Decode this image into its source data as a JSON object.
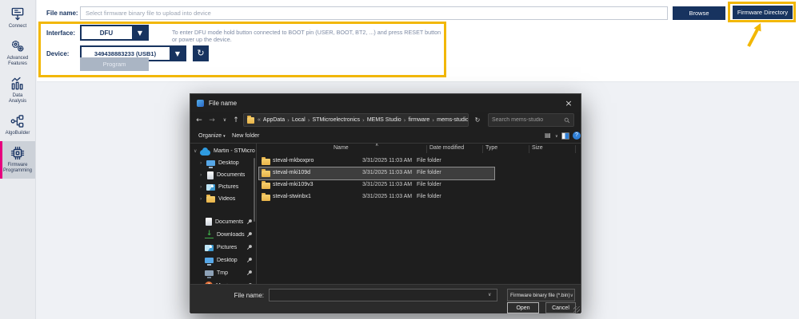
{
  "app": {
    "sidebar": {
      "items": [
        {
          "label": "Connect",
          "icon": "connect",
          "selected": false
        },
        {
          "label": "Advanced Features",
          "icon": "gears",
          "selected": false
        },
        {
          "label": "Data Analysis",
          "icon": "chart",
          "selected": false
        },
        {
          "label": "AlgoBuilder",
          "icon": "algo",
          "selected": false
        },
        {
          "label": "Firmware Programming",
          "icon": "chip",
          "selected": true
        }
      ]
    }
  },
  "firmware": {
    "file_name_label": "File name:",
    "file_input_placeholder": "Select firmware binary file to upload into device",
    "browse_button": "Browse",
    "firmware_directory_button": "Firmware Directory",
    "interface_label": "Interface:",
    "interface_value": "DFU",
    "dfu_note": "To enter DFU mode hold button connected to BOOT pin (USER, BOOT, BT2, ...) and press RESET button or power up the device.",
    "device_label": "Device:",
    "device_value": "349438883233 (USB1)",
    "program_button": "Program"
  },
  "dialog": {
    "title": "File name",
    "address": {
      "overflow": "«",
      "crumbs": [
        "AppData",
        "Local",
        "STMicroelectronics",
        "MEMS Studio",
        "firmware",
        "mems-studio"
      ]
    },
    "search_placeholder": "Search mems-studio",
    "toolbar": {
      "organize": "Organize",
      "new_folder": "New folder"
    },
    "tree": {
      "group1_root": {
        "label": "Martin - STMicro",
        "icon": "cloud"
      },
      "group1_children": [
        {
          "label": "Desktop",
          "icon": "monitor"
        },
        {
          "label": "Documents",
          "icon": "doc"
        },
        {
          "label": "Pictures",
          "icon": "pic"
        },
        {
          "label": "Videos",
          "icon": "folder"
        }
      ],
      "group2": [
        {
          "label": "Documents",
          "icon": "doc"
        },
        {
          "label": "Downloads",
          "icon": "download"
        },
        {
          "label": "Pictures",
          "icon": "pic"
        },
        {
          "label": "Desktop",
          "icon": "monitor"
        },
        {
          "label": "Tmp",
          "icon": "monitor2"
        },
        {
          "label": "Music",
          "icon": "music"
        }
      ]
    },
    "list": {
      "columns": [
        "Name",
        "Date modified",
        "Type",
        "Size"
      ],
      "rows": [
        {
          "name": "steval-mkboxpro",
          "date": "3/31/2025 11:03 AM",
          "type": "File folder",
          "selected": false
        },
        {
          "name": "steval-mki109d",
          "date": "3/31/2025 11:03 AM",
          "type": "File folder",
          "selected": true
        },
        {
          "name": "steval-mki109v3",
          "date": "3/31/2025 11:03 AM",
          "type": "File folder",
          "selected": false
        },
        {
          "name": "steval-stwinbx1",
          "date": "3/31/2025 11:03 AM",
          "type": "File folder",
          "selected": false
        }
      ]
    },
    "footer": {
      "file_name_label": "File name:",
      "file_name_value": "",
      "file_type_value": "Firmware binary file (*.bin)",
      "open_button": "Open",
      "cancel_button": "Cancel"
    }
  },
  "colors": {
    "accent_navy": "#17335f",
    "annotation_yellow": "#f2b705",
    "st_pink": "#e6007e",
    "folder_yellow": "#e9b44a",
    "help_blue": "#2f7fd6",
    "dialog_dark": "#1f1f1f"
  }
}
